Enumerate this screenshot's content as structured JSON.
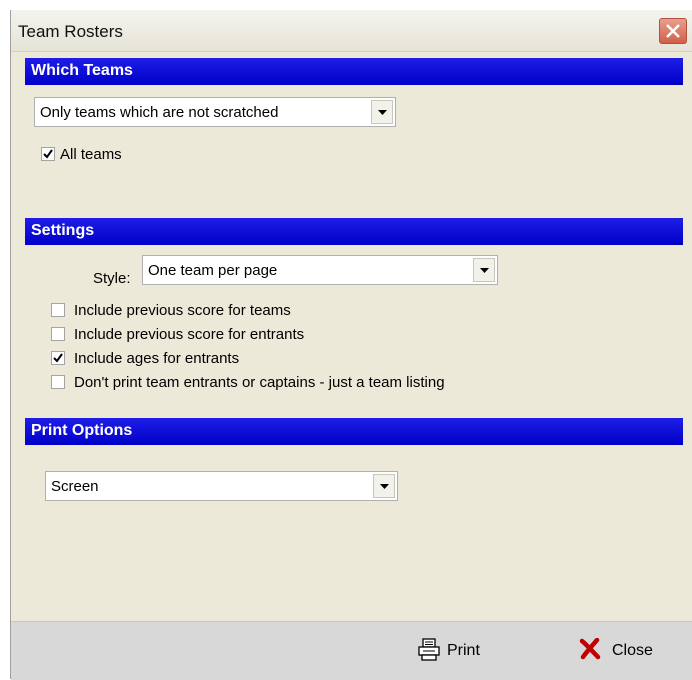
{
  "window": {
    "title": "Team Rosters"
  },
  "sections": {
    "which_teams": "Which Teams",
    "settings": "Settings",
    "print_options": "Print Options"
  },
  "which_teams": {
    "filter_value": "Only teams which are not scratched",
    "all_teams": {
      "label": "All teams",
      "checked": true
    }
  },
  "settings": {
    "style_label": "Style:",
    "style_value": "One team per page",
    "options": [
      {
        "label": "Include previous score for teams",
        "checked": false
      },
      {
        "label": "Include previous score for entrants",
        "checked": false
      },
      {
        "label": "Include ages for entrants",
        "checked": true
      },
      {
        "label": "Don't print team entrants or captains - just a team listing",
        "checked": false
      }
    ]
  },
  "print_options": {
    "destination_value": "Screen"
  },
  "footer": {
    "print_label": "Print",
    "close_label": "Close"
  },
  "icons": {
    "close": "close-icon",
    "dropdown": "chevron-down-icon",
    "checkmark": "checkmark-icon",
    "printer": "printer-icon",
    "close_red": "close-x-icon"
  },
  "colors": {
    "section_bar": "#0000c8",
    "close_button": "#d0604a",
    "close_x": "#c00000"
  }
}
